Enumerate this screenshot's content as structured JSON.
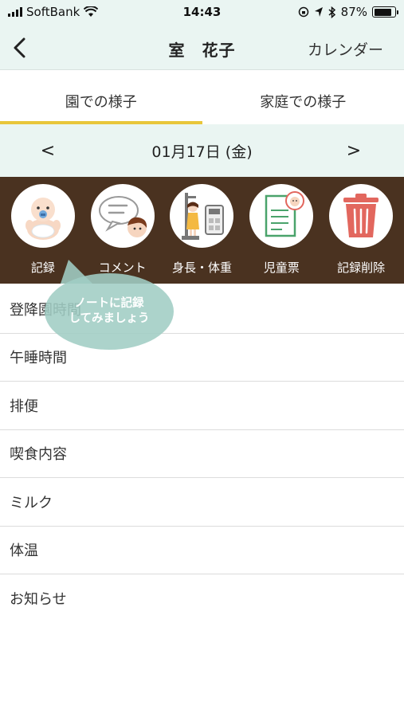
{
  "status_bar": {
    "carrier": "SoftBank",
    "time": "14:43",
    "battery_percent": "87%",
    "battery_level": 0.87
  },
  "nav": {
    "title": "室　花子",
    "right_label": "カレンダー"
  },
  "tabs": [
    {
      "label": "園での様子",
      "active": true
    },
    {
      "label": "家庭での様子",
      "active": false
    }
  ],
  "date": {
    "prev": "<",
    "label": "01月17日 (金)",
    "next": ">"
  },
  "actions": [
    {
      "label": "記録",
      "icon": "baby-icon"
    },
    {
      "label": "コメント",
      "icon": "comment-icon"
    },
    {
      "label": "身長・体重",
      "icon": "height-weight-icon"
    },
    {
      "label": "児童票",
      "icon": "child-record-icon"
    },
    {
      "label": "記録削除",
      "icon": "trash-icon"
    }
  ],
  "tooltip": {
    "line1": "ノートに記録",
    "line2": "してみましょう"
  },
  "menu": [
    {
      "label": "登降園時間"
    },
    {
      "label": "午睡時間"
    },
    {
      "label": "排便"
    },
    {
      "label": "喫食内容"
    },
    {
      "label": "ミルク"
    },
    {
      "label": "体温"
    },
    {
      "label": "お知らせ"
    }
  ],
  "colors": {
    "header_bg": "#eaf5f2",
    "action_bar_bg": "#4a3220",
    "tab_indicator": "#e8c63a",
    "trash_red": "#e2675e",
    "tooltip_bg": "#a0cdc4"
  }
}
